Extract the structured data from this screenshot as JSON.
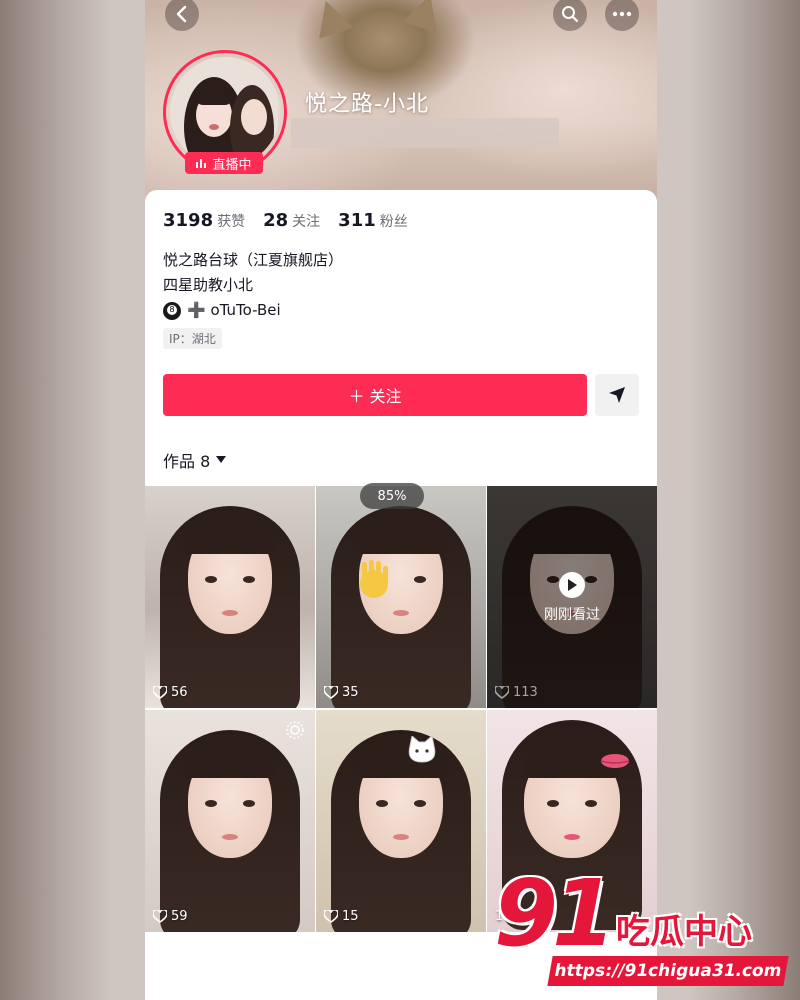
{
  "header": {
    "nickname": "悦之路-小北",
    "live_badge": "直播中",
    "back_icon": "chevron-left-icon",
    "search_icon": "search-icon",
    "more_icon": "more-icon"
  },
  "stats": [
    {
      "value": "3198",
      "label": "获赞"
    },
    {
      "value": "28",
      "label": "关注"
    },
    {
      "value": "311",
      "label": "粉丝"
    }
  ],
  "bio": {
    "line1": "悦之路台球（江夏旗舰店）",
    "line2": "四星助教小北",
    "line3": "➕ oTuTo-Bei",
    "ip": "IP：湖北"
  },
  "actions": {
    "follow_label": "＋ 关注",
    "share_icon": "send-icon"
  },
  "works": {
    "tab_label": "作品 8",
    "zoom": "85%",
    "recent_label": "刚刚看过",
    "videos": [
      {
        "likes": "56"
      },
      {
        "likes": "35"
      },
      {
        "likes": "113"
      },
      {
        "likes": "59"
      },
      {
        "likes": "15"
      },
      {
        "likes": "115"
      }
    ]
  },
  "watermark": {
    "number": "91",
    "text": "吃瓜中心",
    "url": "https://91chigua31.com"
  },
  "colors": {
    "accent": "#fe2c55",
    "watermark": "#e4173b"
  }
}
